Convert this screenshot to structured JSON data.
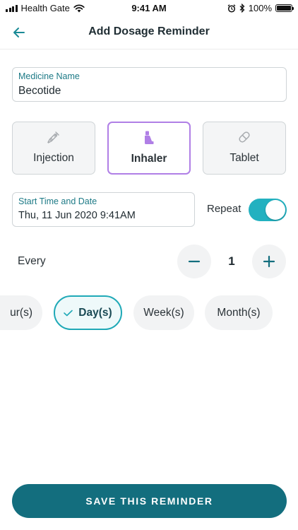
{
  "status_bar": {
    "carrier": "Health Gate",
    "time": "9:41 AM",
    "battery": "100%"
  },
  "header": {
    "title": "Add Dosage Reminder",
    "back_icon": "arrow-left-icon"
  },
  "medicine": {
    "label": "Medicine Name",
    "value": "Becotide"
  },
  "types": [
    {
      "label": "Injection",
      "icon": "syringe-icon",
      "selected": false
    },
    {
      "label": "Inhaler",
      "icon": "inhaler-icon",
      "selected": true
    },
    {
      "label": "Tablet",
      "icon": "pill-icon",
      "selected": false
    }
  ],
  "start": {
    "label": "Start Time and Date",
    "value": "Thu, 11 Jun 2020 9:41AM"
  },
  "repeat": {
    "label": "Repeat",
    "enabled": true
  },
  "every": {
    "label": "Every",
    "value": "1"
  },
  "intervals": [
    {
      "label": "ur(s)",
      "selected": false
    },
    {
      "label": "Day(s)",
      "selected": true
    },
    {
      "label": "Week(s)",
      "selected": false
    },
    {
      "label": "Month(s)",
      "selected": false
    }
  ],
  "save_button": "SAVE THIS REMINDER",
  "colors": {
    "primary": "#136e7e",
    "accent": "#22b1c0",
    "selected_type": "#b07fe6",
    "label": "#1d7a86"
  }
}
